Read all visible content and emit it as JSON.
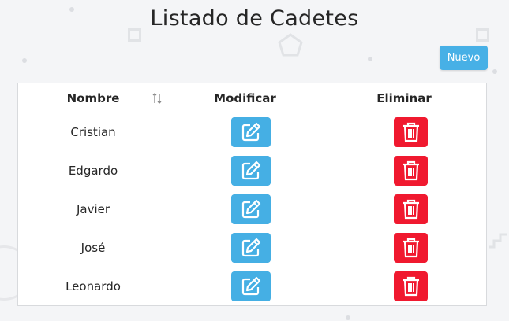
{
  "page": {
    "title": "Listado de Cadetes"
  },
  "toolbar": {
    "new_label": "Nuevo"
  },
  "table": {
    "columns": [
      "Nombre",
      "Modificar",
      "Eliminar"
    ],
    "rows": [
      {
        "name": "Cristian"
      },
      {
        "name": "Edgardo"
      },
      {
        "name": "Javier"
      },
      {
        "name": "José"
      },
      {
        "name": "Leonardo"
      }
    ]
  },
  "icons": {
    "sort": "sort-arrows-icon",
    "edit": "edit-pencil-icon",
    "delete": "trash-icon"
  },
  "colors": {
    "primary": "#47b0e6",
    "danger": "#f0192f",
    "background": "#f4f5f7"
  }
}
